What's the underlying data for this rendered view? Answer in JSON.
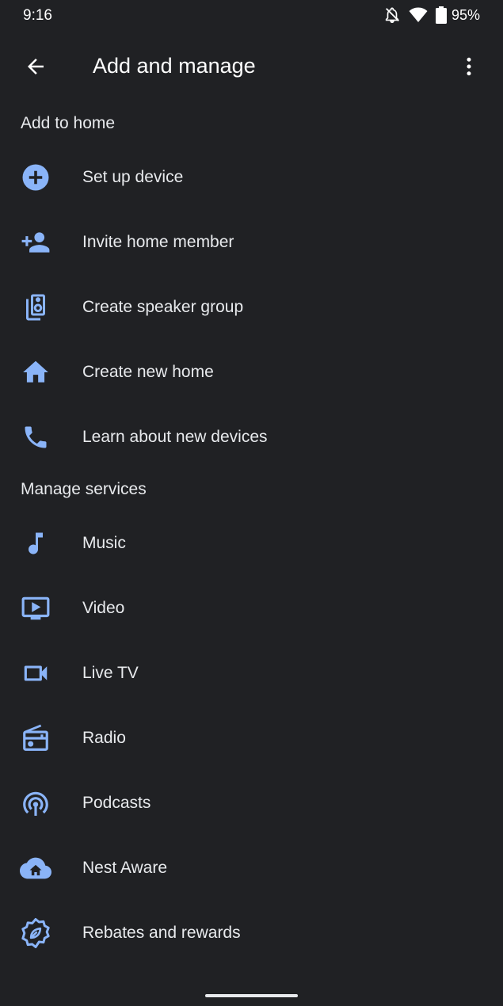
{
  "status_bar": {
    "time": "9:16",
    "battery": "95%"
  },
  "app_bar": {
    "title": "Add and manage"
  },
  "accent_color": "#8ab4f8",
  "sections": {
    "add_to_home": {
      "title": "Add to home",
      "items": [
        {
          "label": "Set up device",
          "icon": "add-circle-icon"
        },
        {
          "label": "Invite home member",
          "icon": "person-add-icon"
        },
        {
          "label": "Create speaker group",
          "icon": "speaker-group-icon"
        },
        {
          "label": "Create new home",
          "icon": "home-icon"
        },
        {
          "label": "Learn about new devices",
          "icon": "phone-icon"
        }
      ]
    },
    "manage_services": {
      "title": "Manage services",
      "items": [
        {
          "label": "Music",
          "icon": "music-note-icon"
        },
        {
          "label": "Video",
          "icon": "video-icon"
        },
        {
          "label": "Live TV",
          "icon": "videocam-icon"
        },
        {
          "label": "Radio",
          "icon": "radio-icon"
        },
        {
          "label": "Podcasts",
          "icon": "podcasts-icon"
        },
        {
          "label": "Nest Aware",
          "icon": "cloud-home-icon"
        },
        {
          "label": "Rebates and rewards",
          "icon": "rewards-badge-icon"
        }
      ]
    }
  }
}
